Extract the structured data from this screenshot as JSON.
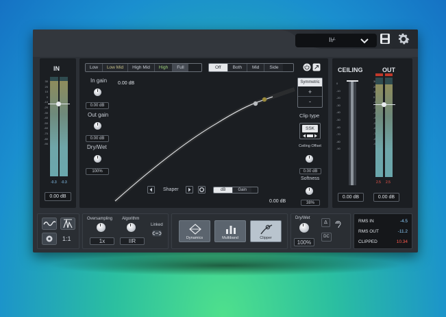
{
  "header": {
    "preset_name": "I⊬"
  },
  "input": {
    "label": "IN",
    "scale": [
      "30",
      "20",
      "10",
      "0",
      "-10",
      "-20",
      "-30",
      "-40",
      "-50",
      "-60",
      "-70",
      "-80",
      "-90"
    ],
    "peak_left": "-0.3",
    "peak_right": "-0.3",
    "gain_value": "0.00 dB"
  },
  "bands": {
    "tabs": [
      "Low",
      "Low Mid",
      "High Mid",
      "High",
      "Full"
    ],
    "active": "Full"
  },
  "stereo": {
    "tabs": [
      "Off",
      "Both",
      "Mid",
      "Side"
    ],
    "active": "Off"
  },
  "controls": {
    "in_gain_label": "In gain",
    "in_gain_value": "0.00 dB",
    "out_gain_label": "Out gain",
    "out_gain_value": "0.00 dB",
    "drywet_label": "Dry/Wet",
    "drywet_value": "100%"
  },
  "graph": {
    "top_left_value": "0.00 dB",
    "bottom_right_value": "0.00 dB",
    "shaper_label": "Shaper",
    "unit_tabs": [
      "dB",
      "Gain"
    ],
    "active_unit": "dB"
  },
  "clip": {
    "symmetric_label": "Symmetric",
    "plus": "+",
    "minus": "-",
    "clip_type_label": "Clip type",
    "clip_type_value": "SSK",
    "ceiling_offset_label": "Ceiling Offset",
    "ceiling_offset_value": "0.00 dB",
    "softness_label": "Softness",
    "softness_value": "38%"
  },
  "output": {
    "ceiling_label": "CEILING",
    "out_label": "OUT",
    "ceiling_scale": [
      "0",
      "-10",
      "-20",
      "-30",
      "-40",
      "-50",
      "-60",
      "-70",
      "-80",
      "-90"
    ],
    "out_scale": [
      "30",
      "20",
      "10",
      "0",
      "-10",
      "-20",
      "-30",
      "-40",
      "-50",
      "-60",
      "-70",
      "-80",
      "-90"
    ],
    "peak_left": "2.5",
    "peak_right": "2.5",
    "ceiling_value": "0.00 dB",
    "out_value": "0.00 dB"
  },
  "bottom": {
    "view_ratio": "1:1",
    "oversampling_label": "Oversampling",
    "oversampling_value": "1x",
    "algorithm_label": "Algorithm",
    "algorithm_value": "IIR",
    "linked_label": "Linked",
    "modes": [
      "Dynamics",
      "Multiband",
      "Clipper"
    ],
    "active_mode": "Clipper",
    "drywet_label": "Dry/Wet",
    "drywet_value": "100%",
    "delta_label": "Δ",
    "dc_label": "DC"
  },
  "rms": {
    "rms_in_label": "RMS IN",
    "rms_in_value": "-4.5",
    "rms_out_label": "RMS OUT",
    "rms_out_value": "-11.2",
    "clipped_label": "CLIPPED",
    "clipped_value": "10.34"
  },
  "colors": {
    "accent_blue": "#8fd0ff",
    "clip_red": "#ff5a4e",
    "band_green": "#9fd37c",
    "band_olive": "#c8c28a"
  }
}
